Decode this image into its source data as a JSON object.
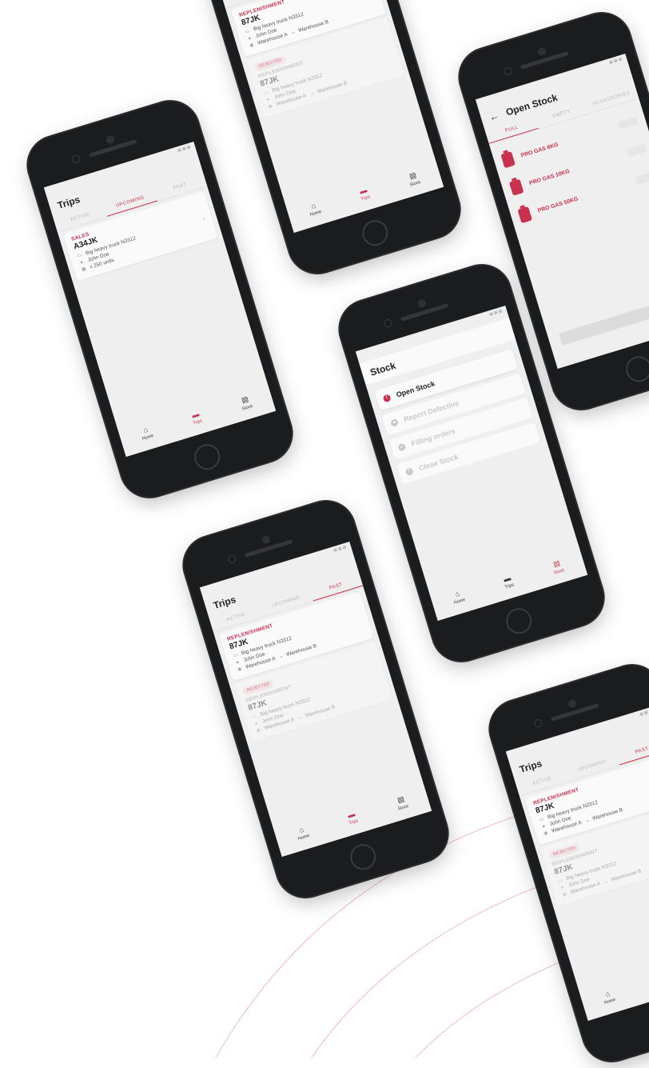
{
  "colors": {
    "accent": "#c8324e",
    "screen_bg": "#efefef",
    "phone_body": "#1b1c1e",
    "deco_line": "#f0c6cc"
  },
  "nav": {
    "home": "Home",
    "trips": "Trips",
    "stock": "Stock"
  },
  "trips_upcoming": {
    "title": "Trips",
    "tabs": [
      "ACTIVE",
      "UPCOMING",
      "PAST"
    ],
    "active_tab": "UPCOMING",
    "card": {
      "type": "SALES",
      "code": "A34JK",
      "vehicle": "Big heavy truck N3312",
      "driver": "John Doe",
      "units": "x 250 units"
    }
  },
  "trips_past": {
    "title": "Trips",
    "tabs": [
      "ACTIVE",
      "UPCOMING",
      "PAST"
    ],
    "active_tab": "PAST",
    "cards": [
      {
        "badge": "",
        "type": "REPLENISHMENT",
        "code": "87JK",
        "vehicle": "Big heavy truck N3312",
        "driver": "John Doe",
        "route_from": "Warehouse A",
        "route_to": "Warehouse B"
      },
      {
        "badge": "REJECTED",
        "type": "REPLENISHMENT",
        "code": "87JK",
        "vehicle": "Big heavy truck N3312",
        "driver": "John Doe",
        "route_from": "Warehouse A",
        "route_to": "Warehouse B"
      }
    ]
  },
  "stock_menu": {
    "title": "Stock",
    "items": [
      "Open Stock",
      "Report Defective",
      "Filling orders",
      "Close Stock"
    ]
  },
  "open_stock": {
    "title": "Open Stock",
    "tabs": [
      "FULL",
      "EMPTY",
      "ACCESSORIES"
    ],
    "products": [
      "PRO GAS 6KG",
      "PRO GAS 10KG",
      "PRO GAS 50KG"
    ]
  },
  "icons": [
    "back-arrow-icon",
    "truck-icon",
    "person-icon",
    "location-pin-icon",
    "box-icon",
    "chevron-right-icon",
    "home-icon",
    "car-icon",
    "clipboard-icon",
    "warning-icon",
    "check-icon",
    "info-icon",
    "gas-cylinder-icon"
  ]
}
